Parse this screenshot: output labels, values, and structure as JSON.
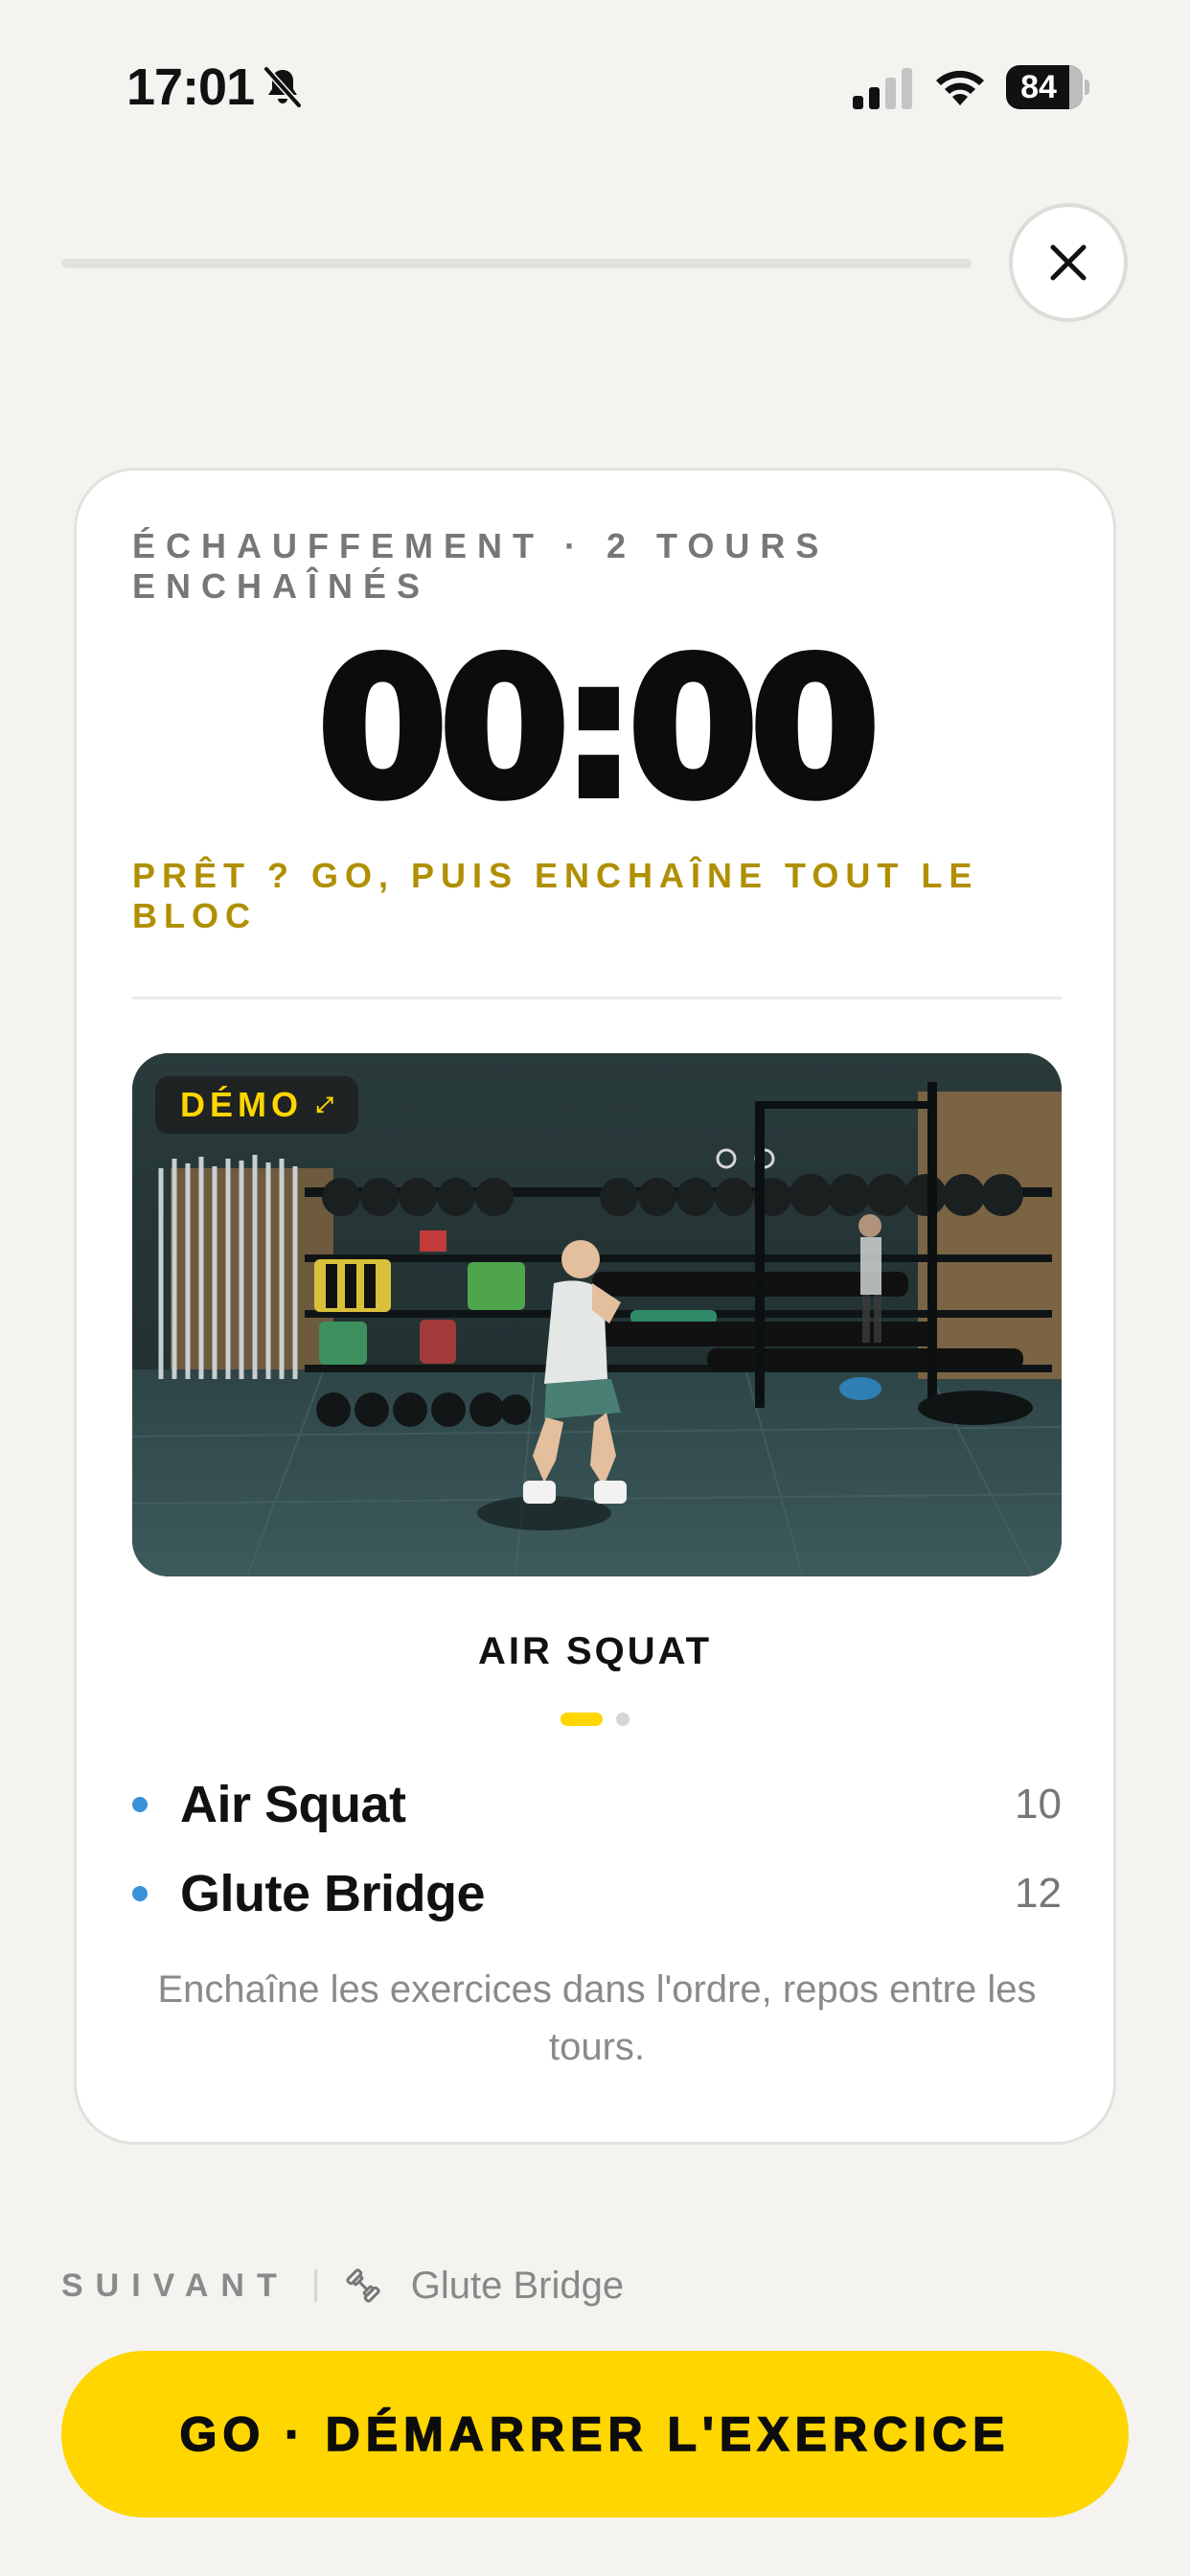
{
  "status_bar": {
    "time": "17:01",
    "battery": "84"
  },
  "progress": {
    "value": 0
  },
  "card": {
    "block_label": "ÉCHAUFFEMENT · 2 TOURS ENCHAÎNÉS",
    "timer": "00:00",
    "hint": "PRÊT ? GO, PUIS ENCHAÎNE TOUT LE BLOC",
    "demo_badge": "DÉMO",
    "exercise_title": "AIR SQUAT",
    "exercises": [
      {
        "name": "Air Squat",
        "reps": "10"
      },
      {
        "name": "Glute Bridge",
        "reps": "12"
      }
    ],
    "note": "Enchaîne les exercices dans l'ordre, repos entre les tours."
  },
  "next": {
    "label": "SUIVANT",
    "name": "Glute Bridge"
  },
  "cta": {
    "label": "GO · DÉMARRER L'EXERCICE"
  },
  "colors": {
    "accent": "#ffd600",
    "hint": "#b08f00",
    "bullet": "#3b91d6",
    "background": "#f4f3f0"
  },
  "icons": [
    "bell-slash-icon",
    "cellular-signal-icon",
    "wifi-icon",
    "battery-icon",
    "close-icon",
    "expand-icon",
    "dumbbell-icon"
  ]
}
